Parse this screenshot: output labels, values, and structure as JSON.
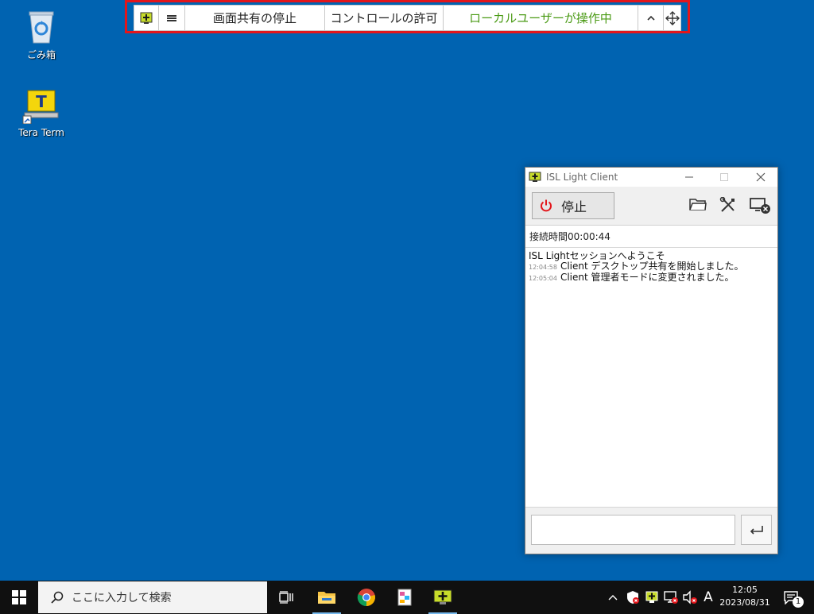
{
  "desktop": {
    "icons": [
      {
        "label": "ごみ箱",
        "icon": "recycle-bin-icon"
      },
      {
        "label": "Tera Term",
        "icon": "tera-term-icon"
      }
    ]
  },
  "session_toolbar": {
    "stop_sharing": "画面共有の停止",
    "allow_control": "コントロールの許可",
    "status": "ローカルユーザーが操作中",
    "status_color": "#4a9a14",
    "highlight_color": "#e3161b"
  },
  "isl_window": {
    "title": "ISL Light Client",
    "stop_label": "停止",
    "connection_time": "接続時間00:00:44",
    "log": {
      "welcome": "ISL Lightセッションへようこそ",
      "entries": [
        {
          "time": "12:04:58",
          "text": "Client デスクトップ共有を開始しました。"
        },
        {
          "time": "12:05:04",
          "text": "Client 管理者モードに変更されました。"
        }
      ]
    }
  },
  "taskbar": {
    "search_placeholder": "ここに入力して検索",
    "time": "12:05",
    "date": "2023/08/31",
    "ime": "A",
    "notification_count": "1"
  },
  "colors": {
    "desktop": "#0063b1",
    "taskbar": "#101010",
    "stop_icon": "#e3161b"
  }
}
